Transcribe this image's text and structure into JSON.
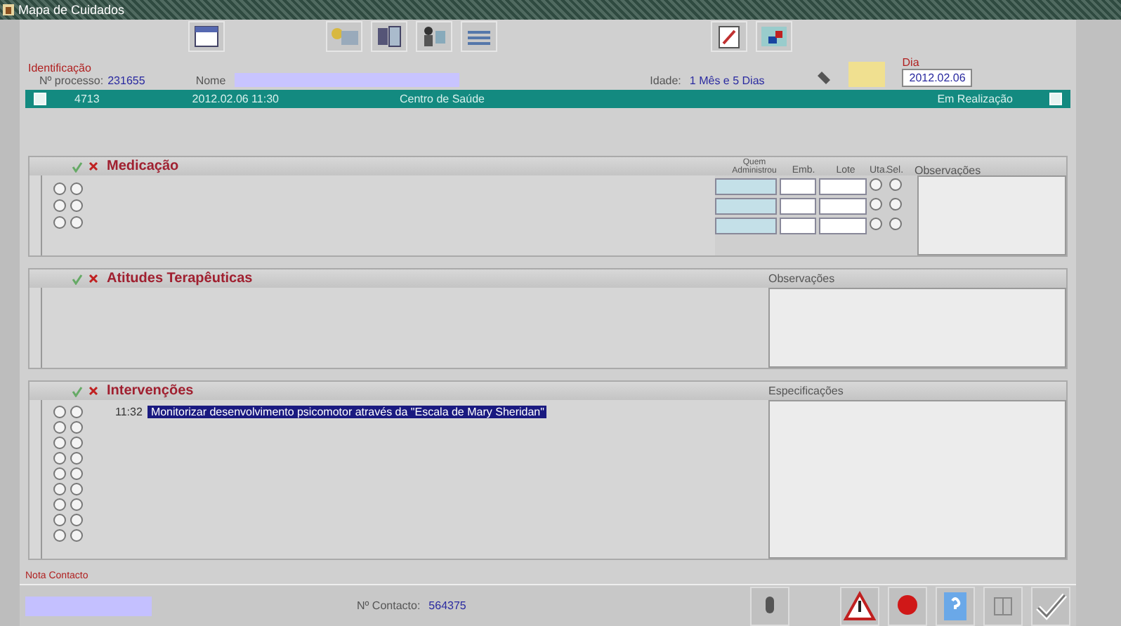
{
  "window": {
    "title": "Mapa de Cuidados"
  },
  "identification": {
    "heading": "Identificação",
    "process_label": "Nº processo:",
    "process_number": "231655",
    "name_label": "Nome",
    "age_label": "Idade:",
    "age": "1 Mês e 5 Dias",
    "day_label": "Dia",
    "day": "2012.02.06"
  },
  "episode": {
    "number": "4713",
    "datetime": "2012.02.06  11:30",
    "place": "Centro de Saúde",
    "status": "Em Realização"
  },
  "medication": {
    "title": "Medicação",
    "columns": [
      "Quem Administrou",
      "Emb.",
      "Lote",
      "Uta.",
      "Sel.",
      "Observações"
    ],
    "rows": [
      {
        "options": [
          {
            "checked": false
          },
          {
            "checked": false
          }
        ],
        "flags": [
          {
            "checked": false
          },
          {
            "checked": false
          }
        ]
      },
      {
        "options": [
          {
            "checked": false
          },
          {
            "checked": false
          }
        ],
        "flags": [
          {
            "checked": false
          },
          {
            "checked": false
          }
        ]
      },
      {
        "options": [
          {
            "checked": false
          },
          {
            "checked": false
          }
        ],
        "flags": [
          {
            "checked": false
          },
          {
            "checked": false
          }
        ]
      }
    ]
  },
  "therapeutic": {
    "title": "Atitudes Terapêuticas",
    "notes_label": "Observações"
  },
  "interventions": {
    "title": "Intervenções",
    "notes_label": "Especificações",
    "rows": [
      {
        "options": [
          {
            "checked": false
          },
          {
            "checked": false
          }
        ],
        "time": "11:32",
        "text": "Monitorizar desenvolvimento psicomotor através da \"Escala de Mary Sheridan\"",
        "selected": true
      },
      {
        "options": [
          {
            "checked": false
          },
          {
            "checked": false
          }
        ],
        "selected": false
      },
      {
        "options": [
          {
            "checked": false
          },
          {
            "checked": false
          }
        ],
        "selected": false
      },
      {
        "options": [
          {
            "checked": false
          },
          {
            "checked": false
          }
        ],
        "selected": false
      },
      {
        "options": [
          {
            "checked": false
          },
          {
            "checked": false
          }
        ],
        "selected": false
      },
      {
        "options": [
          {
            "checked": false
          },
          {
            "checked": false
          }
        ],
        "selected": false
      },
      {
        "options": [
          {
            "checked": false
          },
          {
            "checked": false
          }
        ],
        "selected": false
      },
      {
        "options": [
          {
            "checked": false
          },
          {
            "checked": false
          }
        ],
        "selected": false
      },
      {
        "options": [
          {
            "checked": false
          },
          {
            "checked": false
          }
        ],
        "selected": false
      }
    ]
  },
  "footer": {
    "note_label": "Nota Contacto",
    "contact_label": "Nº Contacto:",
    "contact_number": "564375"
  }
}
